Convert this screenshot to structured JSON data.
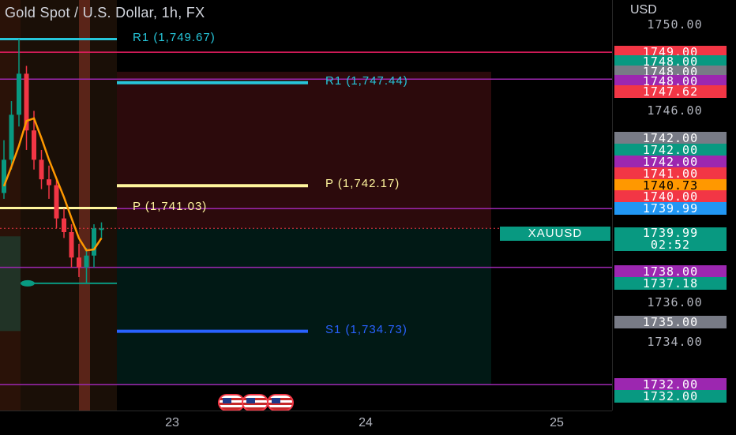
{
  "header": {
    "title": "Gold Spot / U.S. Dollar, 1h, FX"
  },
  "colors": {
    "up": "#089981",
    "down": "#f23645",
    "magenta": "#9c27b0",
    "pink": "#e91e63",
    "cyan": "#26c6da",
    "yellow": "#fff59d",
    "blue": "#2962ff",
    "orange": "#ff9800"
  },
  "chart_data": {
    "type": "candlestick",
    "symbol": "XAUUSD",
    "currency": "USD",
    "ylim": [
      1731.0,
      1750.7
    ],
    "x_ticks": [
      "23",
      "24",
      "25"
    ],
    "candles": [
      {
        "o": 1741.8,
        "h": 1744.5,
        "l": 1741.5,
        "c": 1743.5
      },
      {
        "o": 1743.5,
        "h": 1746.5,
        "l": 1743.0,
        "c": 1745.8
      },
      {
        "o": 1745.8,
        "h": 1749.67,
        "l": 1745.2,
        "c": 1747.9
      },
      {
        "o": 1747.9,
        "h": 1748.3,
        "l": 1744.0,
        "c": 1745.0
      },
      {
        "o": 1745.0,
        "h": 1746.0,
        "l": 1743.0,
        "c": 1743.5
      },
      {
        "o": 1743.5,
        "h": 1744.0,
        "l": 1742.0,
        "c": 1742.5
      },
      {
        "o": 1742.5,
        "h": 1743.2,
        "l": 1741.5,
        "c": 1742.2
      },
      {
        "o": 1742.2,
        "h": 1742.5,
        "l": 1740.0,
        "c": 1740.5
      },
      {
        "o": 1740.5,
        "h": 1741.0,
        "l": 1739.5,
        "c": 1739.8
      },
      {
        "o": 1739.8,
        "h": 1740.2,
        "l": 1738.0,
        "c": 1738.5
      },
      {
        "o": 1738.5,
        "h": 1739.2,
        "l": 1737.5,
        "c": 1738.0
      },
      {
        "o": 1738.0,
        "h": 1739.0,
        "l": 1737.18,
        "c": 1738.6
      },
      {
        "o": 1738.6,
        "h": 1740.2,
        "l": 1738.0,
        "c": 1739.99
      },
      {
        "o": 1739.99,
        "h": 1740.3,
        "l": 1739.5,
        "c": 1739.99
      }
    ],
    "pivot_levels": [
      {
        "label": "R1 (1,749.67)",
        "value": 1749.67,
        "role": "r1-old"
      },
      {
        "label": "R1 (1,747.44)",
        "value": 1747.44,
        "role": "r1"
      },
      {
        "label": "P (1,742.17)",
        "value": 1742.17,
        "role": "p"
      },
      {
        "label": "P (1,741.03)",
        "value": 1741.03,
        "role": "p-old"
      },
      {
        "label": "S1 (1,734.73)",
        "value": 1734.73,
        "role": "s1"
      }
    ],
    "horizontal_lines": [
      1749.0,
      1747.62,
      1741.0,
      1738.0,
      1732.0
    ],
    "position_box": {
      "entry": 1739.99,
      "target_top": 1748.0,
      "stop_bottom": 1732.0
    },
    "price_scale": {
      "ticks": [
        {
          "text": "1750.00",
          "v": 1750.4,
          "bg": "",
          "fg": "#b2b5be"
        },
        {
          "text": "1749.00",
          "v": 1749.0,
          "bg": "#f23645",
          "fg": "#ffffff"
        },
        {
          "text": "1748.00",
          "v": 1748.5,
          "bg": "#089981",
          "fg": "#ffffff"
        },
        {
          "text": "1748.00",
          "v": 1748.0,
          "bg": "#787b86",
          "fg": "#ffffff"
        },
        {
          "text": "1748.00",
          "v": 1747.5,
          "bg": "#9c27b0",
          "fg": "#ffffff"
        },
        {
          "text": "1747.62",
          "v": 1747.0,
          "bg": "#f23645",
          "fg": "#ffffff"
        },
        {
          "text": "1746.00",
          "v": 1746.0,
          "bg": "",
          "fg": "#b2b5be"
        },
        {
          "text": "1742.00",
          "v": 1744.6,
          "bg": "#787b86",
          "fg": "#ffffff"
        },
        {
          "text": "1742.00",
          "v": 1744.0,
          "bg": "#089981",
          "fg": "#ffffff"
        },
        {
          "text": "1742.00",
          "v": 1743.4,
          "bg": "#9c27b0",
          "fg": "#ffffff"
        },
        {
          "text": "1741.00",
          "v": 1742.8,
          "bg": "#f23645",
          "fg": "#ffffff"
        },
        {
          "text": "1740.73",
          "v": 1742.2,
          "bg": "#ff9800",
          "fg": "#000000"
        },
        {
          "text": "1740.00",
          "v": 1741.6,
          "bg": "#f23645",
          "fg": "#ffffff"
        },
        {
          "text": "1739.99",
          "v": 1741.0,
          "bg": "#2196f3",
          "fg": "#ffffff"
        },
        {
          "text": "1738.00",
          "v": 1737.8,
          "bg": "#9c27b0",
          "fg": "#ffffff"
        },
        {
          "text": "1737.18",
          "v": 1737.18,
          "bg": "#089981",
          "fg": "#ffffff"
        },
        {
          "text": "1736.00",
          "v": 1736.2,
          "bg": "",
          "fg": "#b2b5be"
        },
        {
          "text": "1735.00",
          "v": 1735.2,
          "bg": "#787b86",
          "fg": "#ffffff"
        },
        {
          "text": "1734.00",
          "v": 1734.2,
          "bg": "",
          "fg": "#b2b5be"
        },
        {
          "text": "1732.00",
          "v": 1732.0,
          "bg": "#9c27b0",
          "fg": "#ffffff"
        },
        {
          "text": "1732.00",
          "v": 1731.4,
          "bg": "#089981",
          "fg": "#ffffff"
        }
      ],
      "last_price": "1739.99",
      "countdown": "02:52"
    }
  }
}
